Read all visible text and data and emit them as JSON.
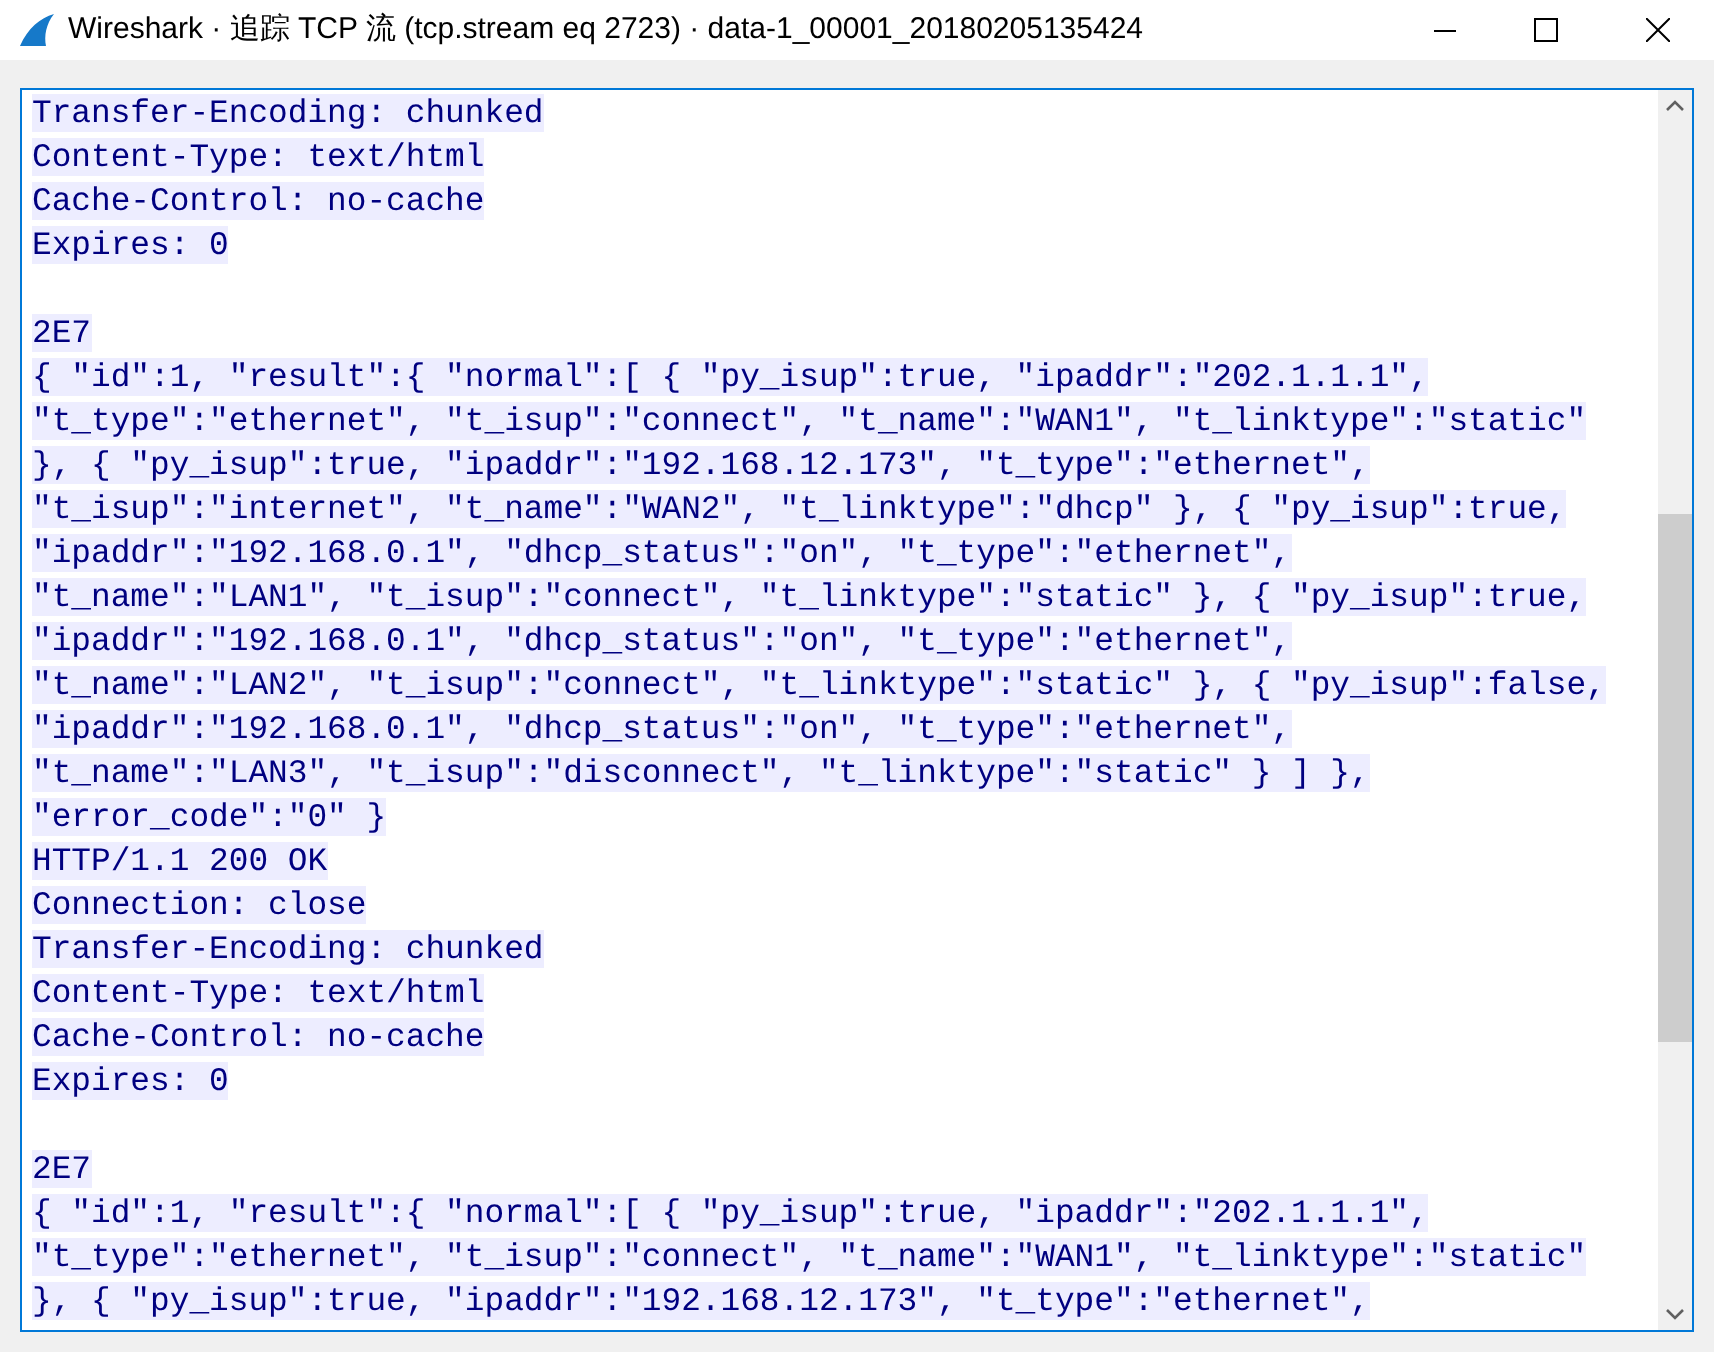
{
  "window": {
    "title": "Wireshark · 追踪 TCP 流 (tcp.stream eq 2723) · data-1_00001_20180205135424"
  },
  "stream": {
    "lines": [
      {
        "kind": "data",
        "text": "Transfer-Encoding: chunked"
      },
      {
        "kind": "data",
        "text": "Content-Type: text/html"
      },
      {
        "kind": "data",
        "text": "Cache-Control: no-cache"
      },
      {
        "kind": "data",
        "text": "Expires: 0"
      },
      {
        "kind": "blank"
      },
      {
        "kind": "data",
        "text": "2E7"
      },
      {
        "kind": "data",
        "text": "{ \"id\":1, \"result\":{ \"normal\":[ { \"py_isup\":true, \"ipaddr\":\"202.1.1.1\","
      },
      {
        "kind": "data",
        "text": "\"t_type\":\"ethernet\", \"t_isup\":\"connect\", \"t_name\":\"WAN1\", \"t_linktype\":\"static\""
      },
      {
        "kind": "data",
        "text": "}, { \"py_isup\":true, \"ipaddr\":\"192.168.12.173\", \"t_type\":\"ethernet\","
      },
      {
        "kind": "data",
        "text": "\"t_isup\":\"internet\", \"t_name\":\"WAN2\", \"t_linktype\":\"dhcp\" }, { \"py_isup\":true,"
      },
      {
        "kind": "data",
        "text": "\"ipaddr\":\"192.168.0.1\", \"dhcp_status\":\"on\", \"t_type\":\"ethernet\","
      },
      {
        "kind": "data",
        "text": "\"t_name\":\"LAN1\", \"t_isup\":\"connect\", \"t_linktype\":\"static\" }, { \"py_isup\":true,"
      },
      {
        "kind": "data",
        "text": "\"ipaddr\":\"192.168.0.1\", \"dhcp_status\":\"on\", \"t_type\":\"ethernet\","
      },
      {
        "kind": "data",
        "text": "\"t_name\":\"LAN2\", \"t_isup\":\"connect\", \"t_linktype\":\"static\" }, { \"py_isup\":false,"
      },
      {
        "kind": "data",
        "text": "\"ipaddr\":\"192.168.0.1\", \"dhcp_status\":\"on\", \"t_type\":\"ethernet\","
      },
      {
        "kind": "data",
        "text": "\"t_name\":\"LAN3\", \"t_isup\":\"disconnect\", \"t_linktype\":\"static\" } ] },"
      },
      {
        "kind": "data",
        "text": "\"error_code\":\"0\" }"
      },
      {
        "kind": "data",
        "text": "HTTP/1.1 200 OK"
      },
      {
        "kind": "data",
        "text": "Connection: close"
      },
      {
        "kind": "data",
        "text": "Transfer-Encoding: chunked"
      },
      {
        "kind": "data",
        "text": "Content-Type: text/html"
      },
      {
        "kind": "data",
        "text": "Cache-Control: no-cache"
      },
      {
        "kind": "data",
        "text": "Expires: 0"
      },
      {
        "kind": "blank"
      },
      {
        "kind": "data",
        "text": "2E7"
      },
      {
        "kind": "data",
        "text": "{ \"id\":1, \"result\":{ \"normal\":[ { \"py_isup\":true, \"ipaddr\":\"202.1.1.1\","
      },
      {
        "kind": "data",
        "text": "\"t_type\":\"ethernet\", \"t_isup\":\"connect\", \"t_name\":\"WAN1\", \"t_linktype\":\"static\""
      },
      {
        "kind": "data",
        "text": "}, { \"py_isup\":true, \"ipaddr\":\"192.168.12.173\", \"t_type\":\"ethernet\","
      }
    ]
  }
}
